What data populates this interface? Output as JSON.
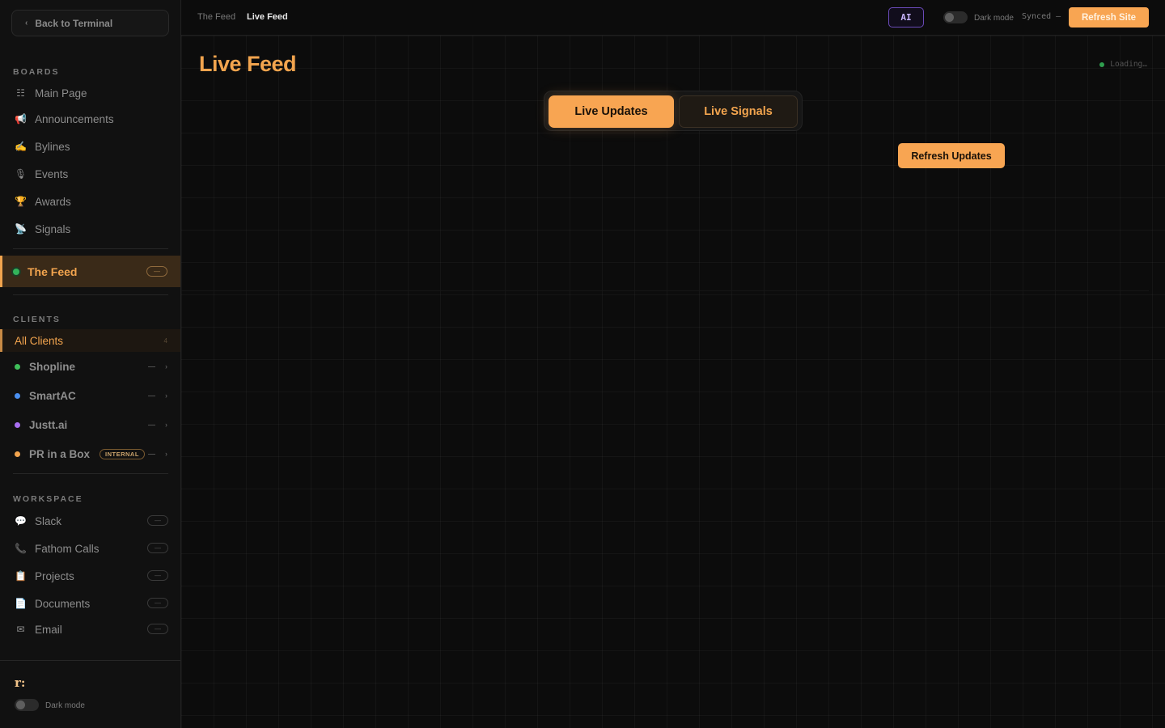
{
  "sidebar": {
    "back_label": "Back to Terminal",
    "boards_title": "BOARDS",
    "boards": [
      {
        "label": "Main Page",
        "icon": "grid-icon",
        "glyph": "☷"
      },
      {
        "label": "Announcements",
        "icon": "megaphone-icon",
        "glyph": "📢"
      },
      {
        "label": "Bylines",
        "icon": "pen-icon",
        "glyph": "✍"
      },
      {
        "label": "Events",
        "icon": "microphone-icon",
        "glyph": "🎙"
      },
      {
        "label": "Awards",
        "icon": "trophy-icon",
        "glyph": "🏆"
      },
      {
        "label": "Signals",
        "icon": "satellite-icon",
        "glyph": "📡"
      }
    ],
    "feed": {
      "label": "The Feed",
      "pill": "—"
    },
    "clients_title": "CLIENTS",
    "all_clients": {
      "label": "All Clients",
      "count": "4"
    },
    "clients": [
      {
        "label": "Shopline",
        "color": "#3fbf5a",
        "dash": "—",
        "arrow": "›",
        "badge": ""
      },
      {
        "label": "SmartAC",
        "color": "#4a8ff0",
        "dash": "—",
        "arrow": "›",
        "badge": ""
      },
      {
        "label": "Justt.ai",
        "color": "#a86ef0",
        "dash": "—",
        "arrow": "›",
        "badge": ""
      },
      {
        "label": "PR in a Box",
        "color": "#f2a44e",
        "dash": "—",
        "arrow": "›",
        "badge": "INTERNAL"
      }
    ],
    "workspace_title": "WORKSPACE",
    "workspace": [
      {
        "label": "Slack",
        "icon": "chat-bubble-icon",
        "glyph": "💬",
        "pill": "—"
      },
      {
        "label": "Fathom Calls",
        "icon": "phone-icon",
        "glyph": "📞",
        "pill": "—"
      },
      {
        "label": "Projects",
        "icon": "clipboard-icon",
        "glyph": "📋",
        "pill": "—"
      },
      {
        "label": "Documents",
        "icon": "document-icon",
        "glyph": "📄",
        "pill": "—"
      },
      {
        "label": "Email",
        "icon": "envelope-icon",
        "glyph": "✉",
        "pill": "—"
      }
    ],
    "logo": "r:",
    "dark_mode_label": "Dark mode"
  },
  "topbar": {
    "breadcrumb_parent": "The Feed",
    "breadcrumb_current": "Live Feed",
    "ai_label": "AI",
    "dark_mode_label": "Dark mode",
    "synced_label": "Synced —",
    "refresh_site_label": "Refresh Site"
  },
  "main": {
    "title": "Live Feed",
    "loading_label": "Loading…",
    "tabs": [
      {
        "label": "Live Updates",
        "active": true
      },
      {
        "label": "Live Signals",
        "active": false
      }
    ],
    "refresh_updates_label": "Refresh Updates"
  },
  "colors": {
    "accent": "#f8a552",
    "background": "#0c0c0c",
    "sidebar": "#111111",
    "ai_purple": "#6a4ab8"
  }
}
